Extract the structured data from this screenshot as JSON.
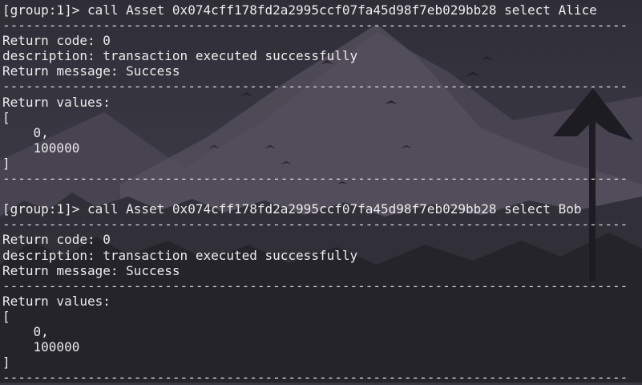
{
  "terminal": {
    "blocks": [
      {
        "prompt": "[group:1]> call Asset 0x074cff178fd2a2995ccf07fa45d98f7eb029bb28 select Alice",
        "return_code": "Return code: 0",
        "description": "description: transaction executed successfully",
        "return_message": "Return message: Success",
        "return_values_label": "Return values:",
        "open_bracket": "[",
        "value_1": "    0,",
        "value_2": "    100000",
        "close_bracket": "]"
      },
      {
        "prompt": "[group:1]> call Asset 0x074cff178fd2a2995ccf07fa45d98f7eb029bb28 select Bob",
        "return_code": "Return code: 0",
        "description": "description: transaction executed successfully",
        "return_message": "Return message: Success",
        "return_values_label": "Return values:",
        "open_bracket": "[",
        "value_1": "    0,",
        "value_2": "    100000",
        "close_bracket": "]"
      }
    ],
    "separator": "---------------------------------------------------------------------------------",
    "colors": {
      "background": "#3a3843",
      "text": "#ececec"
    }
  }
}
